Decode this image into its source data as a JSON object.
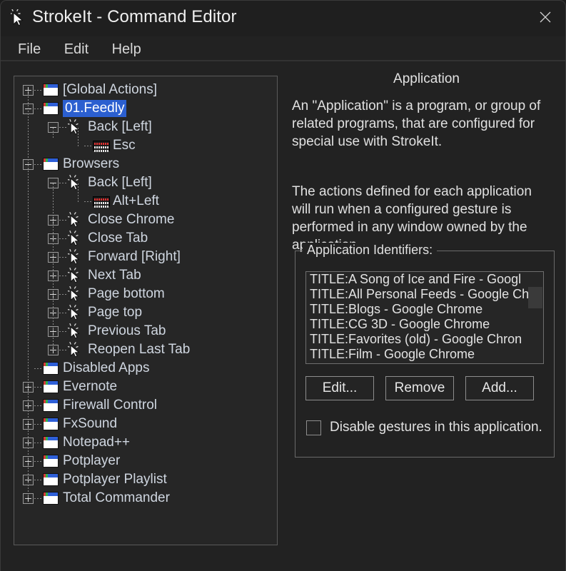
{
  "window": {
    "title": "StrokeIt - Command Editor",
    "icon": "cursor-icon",
    "close_label": "✕"
  },
  "menubar": {
    "items": [
      {
        "label": "File",
        "name": "menu-file"
      },
      {
        "label": "Edit",
        "name": "menu-edit"
      },
      {
        "label": "Help",
        "name": "menu-help"
      }
    ]
  },
  "tree": {
    "nodes": [
      {
        "label": "[Global Actions]",
        "depth": 0,
        "icon": "app-window-icon",
        "expander": "plus",
        "selected": false
      },
      {
        "label": "01.Feedly",
        "depth": 0,
        "icon": "app-window-icon",
        "expander": "minus",
        "selected": true
      },
      {
        "label": "Back [Left]",
        "depth": 1,
        "icon": "gesture-cursor-icon",
        "expander": "minus",
        "selected": false
      },
      {
        "label": "Esc",
        "depth": 2,
        "icon": "keyboard-icon",
        "expander": "none",
        "selected": false
      },
      {
        "label": "Browsers",
        "depth": 0,
        "icon": "app-window-icon",
        "expander": "minus",
        "selected": false
      },
      {
        "label": "Back [Left]",
        "depth": 1,
        "icon": "gesture-cursor-icon",
        "expander": "minus",
        "selected": false
      },
      {
        "label": "Alt+Left",
        "depth": 2,
        "icon": "keyboard-icon",
        "expander": "none",
        "selected": false
      },
      {
        "label": "Close Chrome",
        "depth": 1,
        "icon": "gesture-cursor-icon",
        "expander": "plus",
        "selected": false
      },
      {
        "label": "Close Tab",
        "depth": 1,
        "icon": "gesture-cursor-icon",
        "expander": "plus",
        "selected": false
      },
      {
        "label": "Forward [Right]",
        "depth": 1,
        "icon": "gesture-cursor-icon",
        "expander": "plus",
        "selected": false
      },
      {
        "label": "Next Tab",
        "depth": 1,
        "icon": "gesture-cursor-icon",
        "expander": "plus",
        "selected": false
      },
      {
        "label": "Page bottom",
        "depth": 1,
        "icon": "gesture-cursor-icon",
        "expander": "plus",
        "selected": false
      },
      {
        "label": "Page top",
        "depth": 1,
        "icon": "gesture-cursor-icon",
        "expander": "plus",
        "selected": false
      },
      {
        "label": "Previous Tab",
        "depth": 1,
        "icon": "gesture-cursor-icon",
        "expander": "plus",
        "selected": false
      },
      {
        "label": "Reopen Last Tab",
        "depth": 1,
        "icon": "gesture-cursor-icon",
        "expander": "plus",
        "selected": false
      },
      {
        "label": "Disabled Apps",
        "depth": 0,
        "icon": "app-window-icon",
        "expander": "none",
        "selected": false
      },
      {
        "label": "Evernote",
        "depth": 0,
        "icon": "app-window-icon",
        "expander": "plus",
        "selected": false
      },
      {
        "label": "Firewall Control",
        "depth": 0,
        "icon": "app-window-icon",
        "expander": "plus",
        "selected": false
      },
      {
        "label": "FxSound",
        "depth": 0,
        "icon": "app-window-icon",
        "expander": "plus",
        "selected": false
      },
      {
        "label": "Notepad++",
        "depth": 0,
        "icon": "app-window-icon",
        "expander": "plus",
        "selected": false
      },
      {
        "label": "Potplayer",
        "depth": 0,
        "icon": "app-window-icon",
        "expander": "plus",
        "selected": false
      },
      {
        "label": "Potplayer Playlist",
        "depth": 0,
        "icon": "app-window-icon",
        "expander": "plus",
        "selected": false
      },
      {
        "label": "Total Commander",
        "depth": 0,
        "icon": "app-window-icon",
        "expander": "plus",
        "selected": false
      }
    ]
  },
  "details": {
    "heading": "Application",
    "paragraph1": "An \"Application\" is a program, or group of related programs, that are configured for special use with StrokeIt.",
    "paragraph2": "The actions defined for each application will run when a configured gesture is performed in any window owned by the application.",
    "identifiers": {
      "legend": "Application Identifiers:",
      "items": [
        "TITLE:A Song of Ice and Fire - Googl",
        "TITLE:All Personal Feeds - Google Ch",
        "TITLE:Blogs - Google Chrome",
        "TITLE:CG 3D - Google Chrome",
        "TITLE:Favorites (old) - Google Chron",
        "TITLE:Film - Google Chrome"
      ],
      "buttons": {
        "edit": "Edit...",
        "remove": "Remove",
        "add": "Add..."
      },
      "disable_checkbox_label": "Disable gestures in this application.",
      "disable_checkbox_checked": false
    }
  },
  "colors": {
    "window_background": "#222222",
    "titlebar_background": "#1f1f1f",
    "panel_background": "#262626",
    "selection_blue": "#2b5fd0",
    "text": "#cfd6e0",
    "border": "#5a5a5a"
  }
}
